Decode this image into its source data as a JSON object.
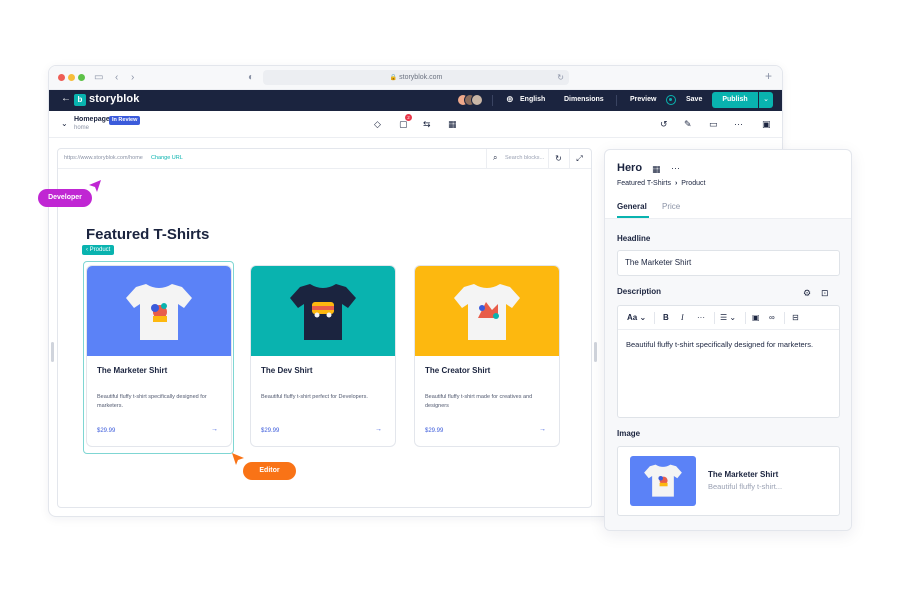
{
  "browser": {
    "url": "storyblok.com",
    "traffic_light_colors": [
      "#ee5e56",
      "#f6bd3b",
      "#5ec248"
    ]
  },
  "topbar": {
    "logo": "storyblok",
    "language": "English",
    "dimensions": "Dimensions",
    "preview": "Preview",
    "save": "Save",
    "publish": "Publish",
    "avatar_colors": [
      "#f0a98b",
      "#8b6c5c",
      "#c9b6a6"
    ]
  },
  "story": {
    "name": "Homepage",
    "slug": "home",
    "status": "In Review",
    "comment_count": "2"
  },
  "canvas": {
    "url": "https://www.storyblok.com/home",
    "change_url": "Change URL",
    "search_placeholder": "Search blocks...",
    "section_title": "Featured T-Shirts",
    "selected_tag": "Product",
    "products": [
      {
        "name": "The Marketer Shirt",
        "description": "Beautiful fluffy t-shirt specifically designed for marketers.",
        "price": "$29.99",
        "bg_color": "#5b82f7",
        "shirt_color": "#f4f4f4",
        "print": "marketer"
      },
      {
        "name": "The Dev Shirt",
        "description": "Beautiful fluffy t-shirt perfect for Developers.",
        "price": "$29.99",
        "bg_color": "#09b3af",
        "shirt_color": "#1b243f",
        "print": "dev"
      },
      {
        "name": "The Creator Shirt",
        "description": "Beautiful fluffy t-shirt made for creatives and designers",
        "price": "$29.99",
        "bg_color": "#fdb80f",
        "shirt_color": "#f4f4f4",
        "print": "creator"
      }
    ]
  },
  "cursors": {
    "developer": {
      "label": "Developer",
      "color": "#c026d3"
    },
    "editor": {
      "label": "Editor",
      "color": "#f97316"
    }
  },
  "panel": {
    "title": "Hero",
    "breadcrumb": [
      "Featured T-Shirts",
      "Product"
    ],
    "tabs": [
      "General",
      "Price"
    ],
    "active_tab": "General",
    "headline_label": "Headline",
    "headline_value": "The Marketer Shirt",
    "description_label": "Description",
    "text_style": "Aa",
    "description_value": "Beautiful fluffy t-shirt specifically designed for marketers.",
    "image_label": "Image",
    "image_name": "The Marketer Shirt",
    "image_desc": "Beautiful fluffy t-shirt..."
  }
}
